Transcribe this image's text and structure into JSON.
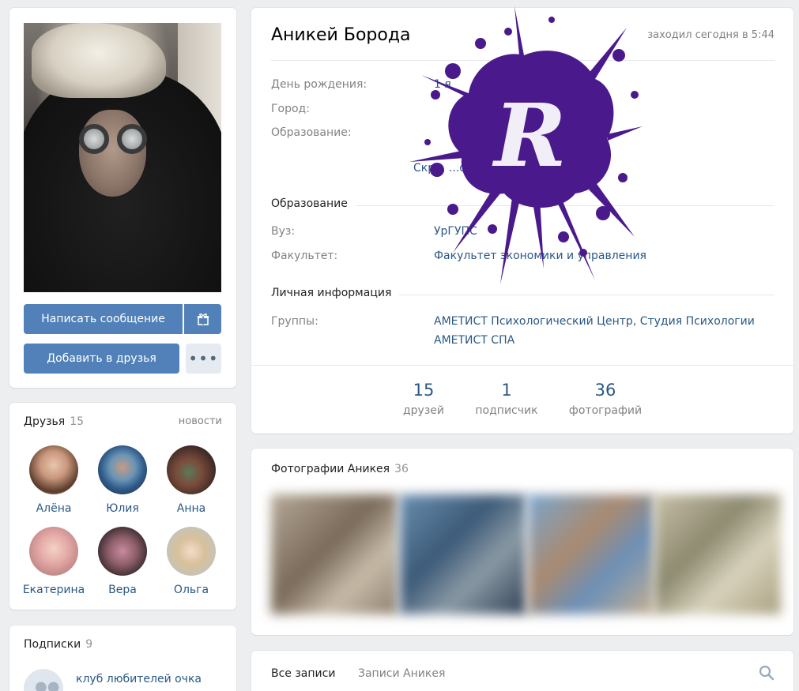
{
  "profile": {
    "name": "Аникей Борода",
    "last_seen": "заходил сегодня в 5:44",
    "info": [
      {
        "label": "День рождения:",
        "value": "1 я"
      },
      {
        "label": "Город:",
        "value": ""
      },
      {
        "label": "Образование:",
        "value": ""
      }
    ],
    "details_link": "Скр... ...формацию",
    "education_section": "Образование",
    "uni_label": "Вуз:",
    "uni_value": "УрГУПС",
    "faculty_label": "Факультет:",
    "faculty_value": "Факультет экономики и управления",
    "personal_section": "Личная информация",
    "groups_label": "Группы:",
    "groups_value_1": "АМЕТИСТ Психологический Центр",
    "groups_sep": ", ",
    "groups_value_2": "Студия Психологии АМЕТИСТ СПА",
    "stats": [
      {
        "num": "15",
        "label": "друзей"
      },
      {
        "num": "1",
        "label": "подписчик"
      },
      {
        "num": "36",
        "label": "фотографий"
      }
    ]
  },
  "actions": {
    "message": "Написать сообщение",
    "add_friend": "Добавить в друзья",
    "more": "•••"
  },
  "friends": {
    "title": "Друзья",
    "count": "15",
    "news": "новости",
    "items": [
      {
        "name": "Алёна"
      },
      {
        "name": "Юлия"
      },
      {
        "name": "Анна"
      },
      {
        "name": "Екатерина"
      },
      {
        "name": "Вера"
      },
      {
        "name": "Ольга"
      }
    ]
  },
  "subscriptions": {
    "title": "Подписки",
    "count": "9",
    "first": "клуб любителей очка"
  },
  "photos": {
    "title": "Фотографии Аникея",
    "count": "36"
  },
  "wall": {
    "all": "Все записи",
    "own": "Записи Аникея"
  },
  "watermark": {
    "letter": "R",
    "color": "#4a1a8c"
  },
  "colors": {
    "accent": "#5181b8",
    "link": "#2a5885",
    "background": "#edeef0"
  }
}
